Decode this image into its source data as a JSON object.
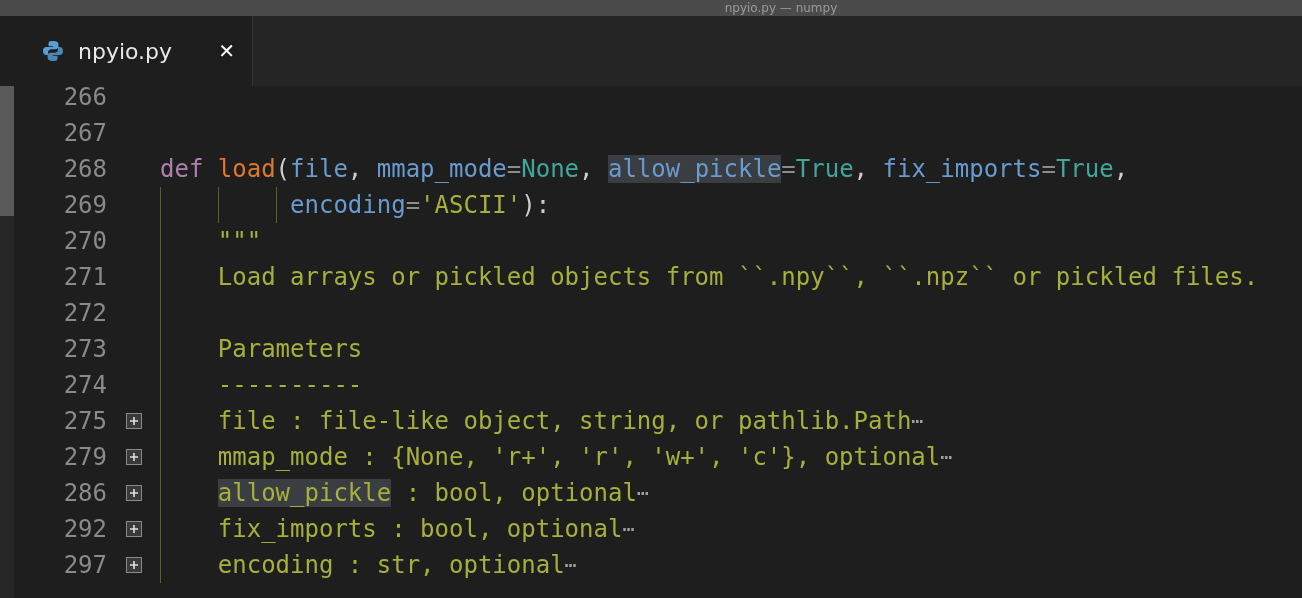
{
  "window": {
    "title": "npyio.py — numpy"
  },
  "tabs": [
    {
      "label": "npyio.py",
      "close": "✕",
      "selected": true
    }
  ],
  "editor": {
    "lines": [
      {
        "number": "266",
        "collapsed": false
      },
      {
        "number": "267",
        "collapsed": false
      },
      {
        "number": "268",
        "collapsed": false,
        "tokens": [
          {
            "kind": "keyword",
            "text": "def "
          },
          {
            "kind": "function",
            "text": "load"
          },
          {
            "kind": "punct",
            "text": "("
          },
          {
            "kind": "param",
            "text": "file"
          },
          {
            "kind": "punct",
            "text": ", "
          },
          {
            "kind": "param",
            "text": "mmap_mode"
          },
          {
            "kind": "operator",
            "text": "="
          },
          {
            "kind": "constant",
            "text": "None"
          },
          {
            "kind": "punct",
            "text": ", "
          },
          {
            "kind": "param",
            "text": "allow_pickle",
            "highlighted": true
          },
          {
            "kind": "operator",
            "text": "="
          },
          {
            "kind": "constant",
            "text": "True"
          },
          {
            "kind": "punct",
            "text": ", "
          },
          {
            "kind": "param",
            "text": "fix_imports"
          },
          {
            "kind": "operator",
            "text": "="
          },
          {
            "kind": "constant",
            "text": "True"
          },
          {
            "kind": "punct",
            "text": ","
          }
        ]
      },
      {
        "number": "269",
        "collapsed": false,
        "tokens": [
          {
            "kind": "param",
            "text": "         encoding"
          },
          {
            "kind": "operator",
            "text": "="
          },
          {
            "kind": "string",
            "text": "'ASCII'"
          },
          {
            "kind": "punct",
            "text": "):"
          }
        ]
      },
      {
        "number": "270",
        "collapsed": false,
        "tokens": [
          {
            "kind": "string",
            "text": "    \"\"\""
          }
        ]
      },
      {
        "number": "271",
        "collapsed": false,
        "tokens": [
          {
            "kind": "string",
            "text": "    Load arrays or pickled objects from ``.npy``, ``.npz`` or pickled files."
          }
        ]
      },
      {
        "number": "272",
        "collapsed": false
      },
      {
        "number": "273",
        "collapsed": false,
        "tokens": [
          {
            "kind": "string",
            "text": "    Parameters"
          }
        ]
      },
      {
        "number": "274",
        "collapsed": false,
        "tokens": [
          {
            "kind": "string",
            "text": "    ----------"
          }
        ]
      },
      {
        "number": "275",
        "collapsed": true,
        "ellipsis": "⋯",
        "tokens": [
          {
            "kind": "string",
            "text": "    file : file-like object, string, or pathlib.Path"
          }
        ]
      },
      {
        "number": "279",
        "collapsed": true,
        "ellipsis": "⋯",
        "tokens": [
          {
            "kind": "string",
            "text": "    mmap_mode : {None, 'r+', 'r', 'w+', 'c'}, optional"
          }
        ]
      },
      {
        "number": "286",
        "collapsed": true,
        "ellipsis": "⋯",
        "tokens": [
          {
            "kind": "string",
            "text": "    allow_pickle",
            "highlighted": true
          },
          {
            "kind": "string",
            "text": " : bool, optional"
          }
        ]
      },
      {
        "number": "292",
        "collapsed": true,
        "ellipsis": "⋯",
        "tokens": [
          {
            "kind": "string",
            "text": "    fix_imports : bool, optional"
          }
        ]
      },
      {
        "number": "297",
        "collapsed": true,
        "ellipsis": "⋯",
        "tokens": [
          {
            "kind": "string",
            "text": "    encoding : str, optional"
          }
        ]
      }
    ]
  }
}
